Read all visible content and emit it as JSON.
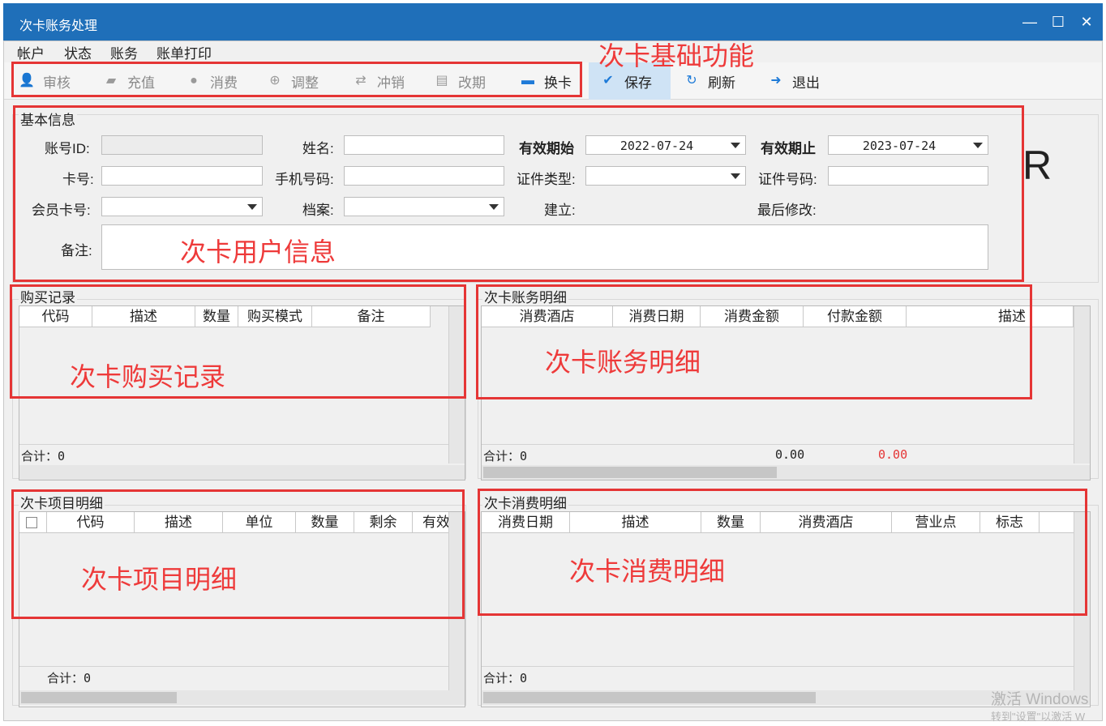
{
  "window": {
    "title": "次卡账务处理",
    "min": "—",
    "max": "☐",
    "close": "✕"
  },
  "menu": [
    "帐户",
    "状态",
    "账务",
    "账单打印"
  ],
  "toolbar": {
    "audit": "审核",
    "recharge": "充值",
    "consume": "消费",
    "adjust": "调整",
    "reverse": "冲销",
    "reschedule": "改期",
    "change_card": "换卡",
    "save": "保存",
    "refresh": "刷新",
    "exit": "退出"
  },
  "annotations": {
    "basic_functions": "次卡基础功能",
    "user_info": "次卡用户信息",
    "purchase_records": "次卡购买记录",
    "account_detail": "次卡账务明细",
    "item_detail": "次卡项目明细",
    "consume_detail": "次卡消费明细"
  },
  "basic_info": {
    "title": "基本信息",
    "account_id_label": "账号ID:",
    "account_id": "",
    "name_label": "姓名:",
    "name": "",
    "valid_start_label": "有效期始",
    "valid_start": "2022-07-24",
    "valid_end_label": "有效期止",
    "valid_end": "2023-07-24",
    "card_no_label": "卡号:",
    "card_no": "",
    "mobile_label": "手机号码:",
    "mobile": "",
    "id_type_label": "证件类型:",
    "id_type": "",
    "id_no_label": "证件号码:",
    "id_no": "",
    "member_card_label": "会员卡号:",
    "member_card": "",
    "archive_label": "档案:",
    "archive": "",
    "created_label": "建立:",
    "created": "",
    "modified_label": "最后修改:",
    "modified": "",
    "remark_label": "备注:",
    "remark": ""
  },
  "side_letter": "R",
  "purchase": {
    "title": "购买记录",
    "columns": [
      "代码",
      "描述",
      "数量",
      "购买模式",
      "备注"
    ],
    "total": "合计：0"
  },
  "account": {
    "title": "次卡账务明细",
    "columns": [
      "消费酒店",
      "消费日期",
      "消费金额",
      "付款金额",
      "描述"
    ],
    "total": "合计：0",
    "consume_sum": "0.00",
    "pay_sum": "0.00"
  },
  "items": {
    "title": "次卡项目明细",
    "columns": [
      "代码",
      "描述",
      "单位",
      "数量",
      "剩余",
      "有效"
    ],
    "total": "合计：0"
  },
  "consume": {
    "title": "次卡消费明细",
    "columns": [
      "消费日期",
      "描述",
      "数量",
      "消费酒店",
      "营业点",
      "标志"
    ],
    "total": "合计：0"
  },
  "watermark": {
    "line1": "激活 Windows",
    "line2": "转到\"设置\"以激活 W"
  },
  "colors": {
    "titlebar": "#1f6fb9",
    "annotation": "#e53535",
    "pay_sum": "#e53535"
  }
}
